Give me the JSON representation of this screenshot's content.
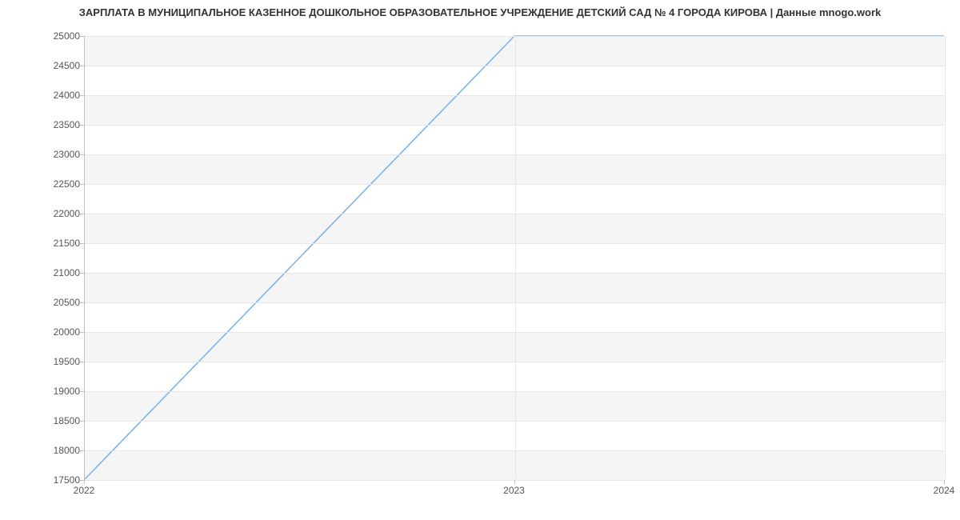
{
  "chart_data": {
    "type": "line",
    "title": "ЗАРПЛАТА В МУНИЦИПАЛЬНОЕ КАЗЕННОЕ ДОШКОЛЬНОЕ ОБРАЗОВАТЕЛЬНОЕ УЧРЕЖДЕНИЕ ДЕТСКИЙ САД № 4 ГОРОДА КИРОВА | Данные mnogo.work",
    "x": [
      2022,
      2023,
      2024
    ],
    "values": [
      17500,
      25000,
      25000
    ],
    "x_ticks": [
      2022,
      2023,
      2024
    ],
    "y_ticks": [
      17500,
      18000,
      18500,
      19000,
      19500,
      20000,
      20500,
      21000,
      21500,
      22000,
      22500,
      23000,
      23500,
      24000,
      24500,
      25000
    ],
    "xlim": [
      2022,
      2024
    ],
    "ylim": [
      17500,
      25000
    ],
    "xlabel": "",
    "ylabel": "",
    "line_color": "#7cb5ec"
  }
}
